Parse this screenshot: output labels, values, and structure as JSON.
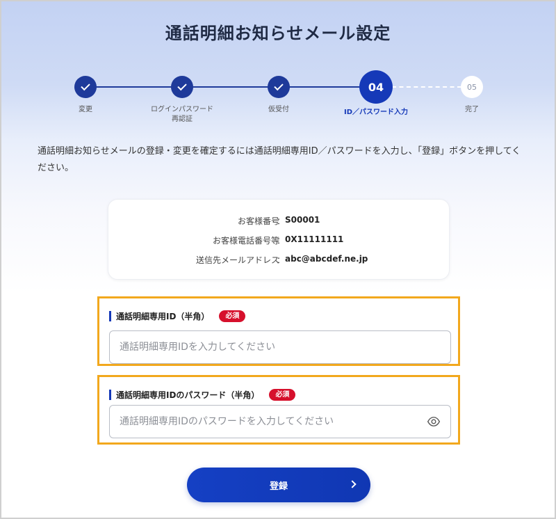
{
  "page": {
    "title": "通話明細お知らせメール設定"
  },
  "stepper": {
    "steps": [
      {
        "label": "変更",
        "state": "done"
      },
      {
        "label": "ログインパスワード",
        "label2": "再認証",
        "state": "done"
      },
      {
        "label": "仮受付",
        "state": "done"
      },
      {
        "number": "04",
        "label": "ID／パスワード入力",
        "state": "current"
      },
      {
        "number": "05",
        "label": "完了",
        "state": "future"
      }
    ]
  },
  "description": "通話明細お知らせメールの登録・変更を確定するには通話明細専用ID／パスワードを入力し、「登録」ボタンを押してください。",
  "info": {
    "separator": "：",
    "rows": [
      {
        "label": "お客様番号",
        "value": "S00001"
      },
      {
        "label": "お客様電話番号等",
        "value": "0X11111111"
      },
      {
        "label": "送信先メールアドレス",
        "value": "abc@abcdef.ne.jp"
      }
    ]
  },
  "form": {
    "id_field": {
      "label": "通話明細専用ID（半角）",
      "badge": "必須",
      "value": "",
      "placeholder": "通話明細専用IDを入力してください"
    },
    "password_field": {
      "label": "通話明細専用IDのパスワード（半角）",
      "badge": "必須",
      "value": "",
      "placeholder": "通話明細専用IDのパスワードを入力してください",
      "icon": "eye-icon"
    },
    "submit_label": "登録"
  },
  "colors": {
    "accent": "#1539b8",
    "highlight_border": "#f2a81d",
    "required": "#d6102c"
  }
}
